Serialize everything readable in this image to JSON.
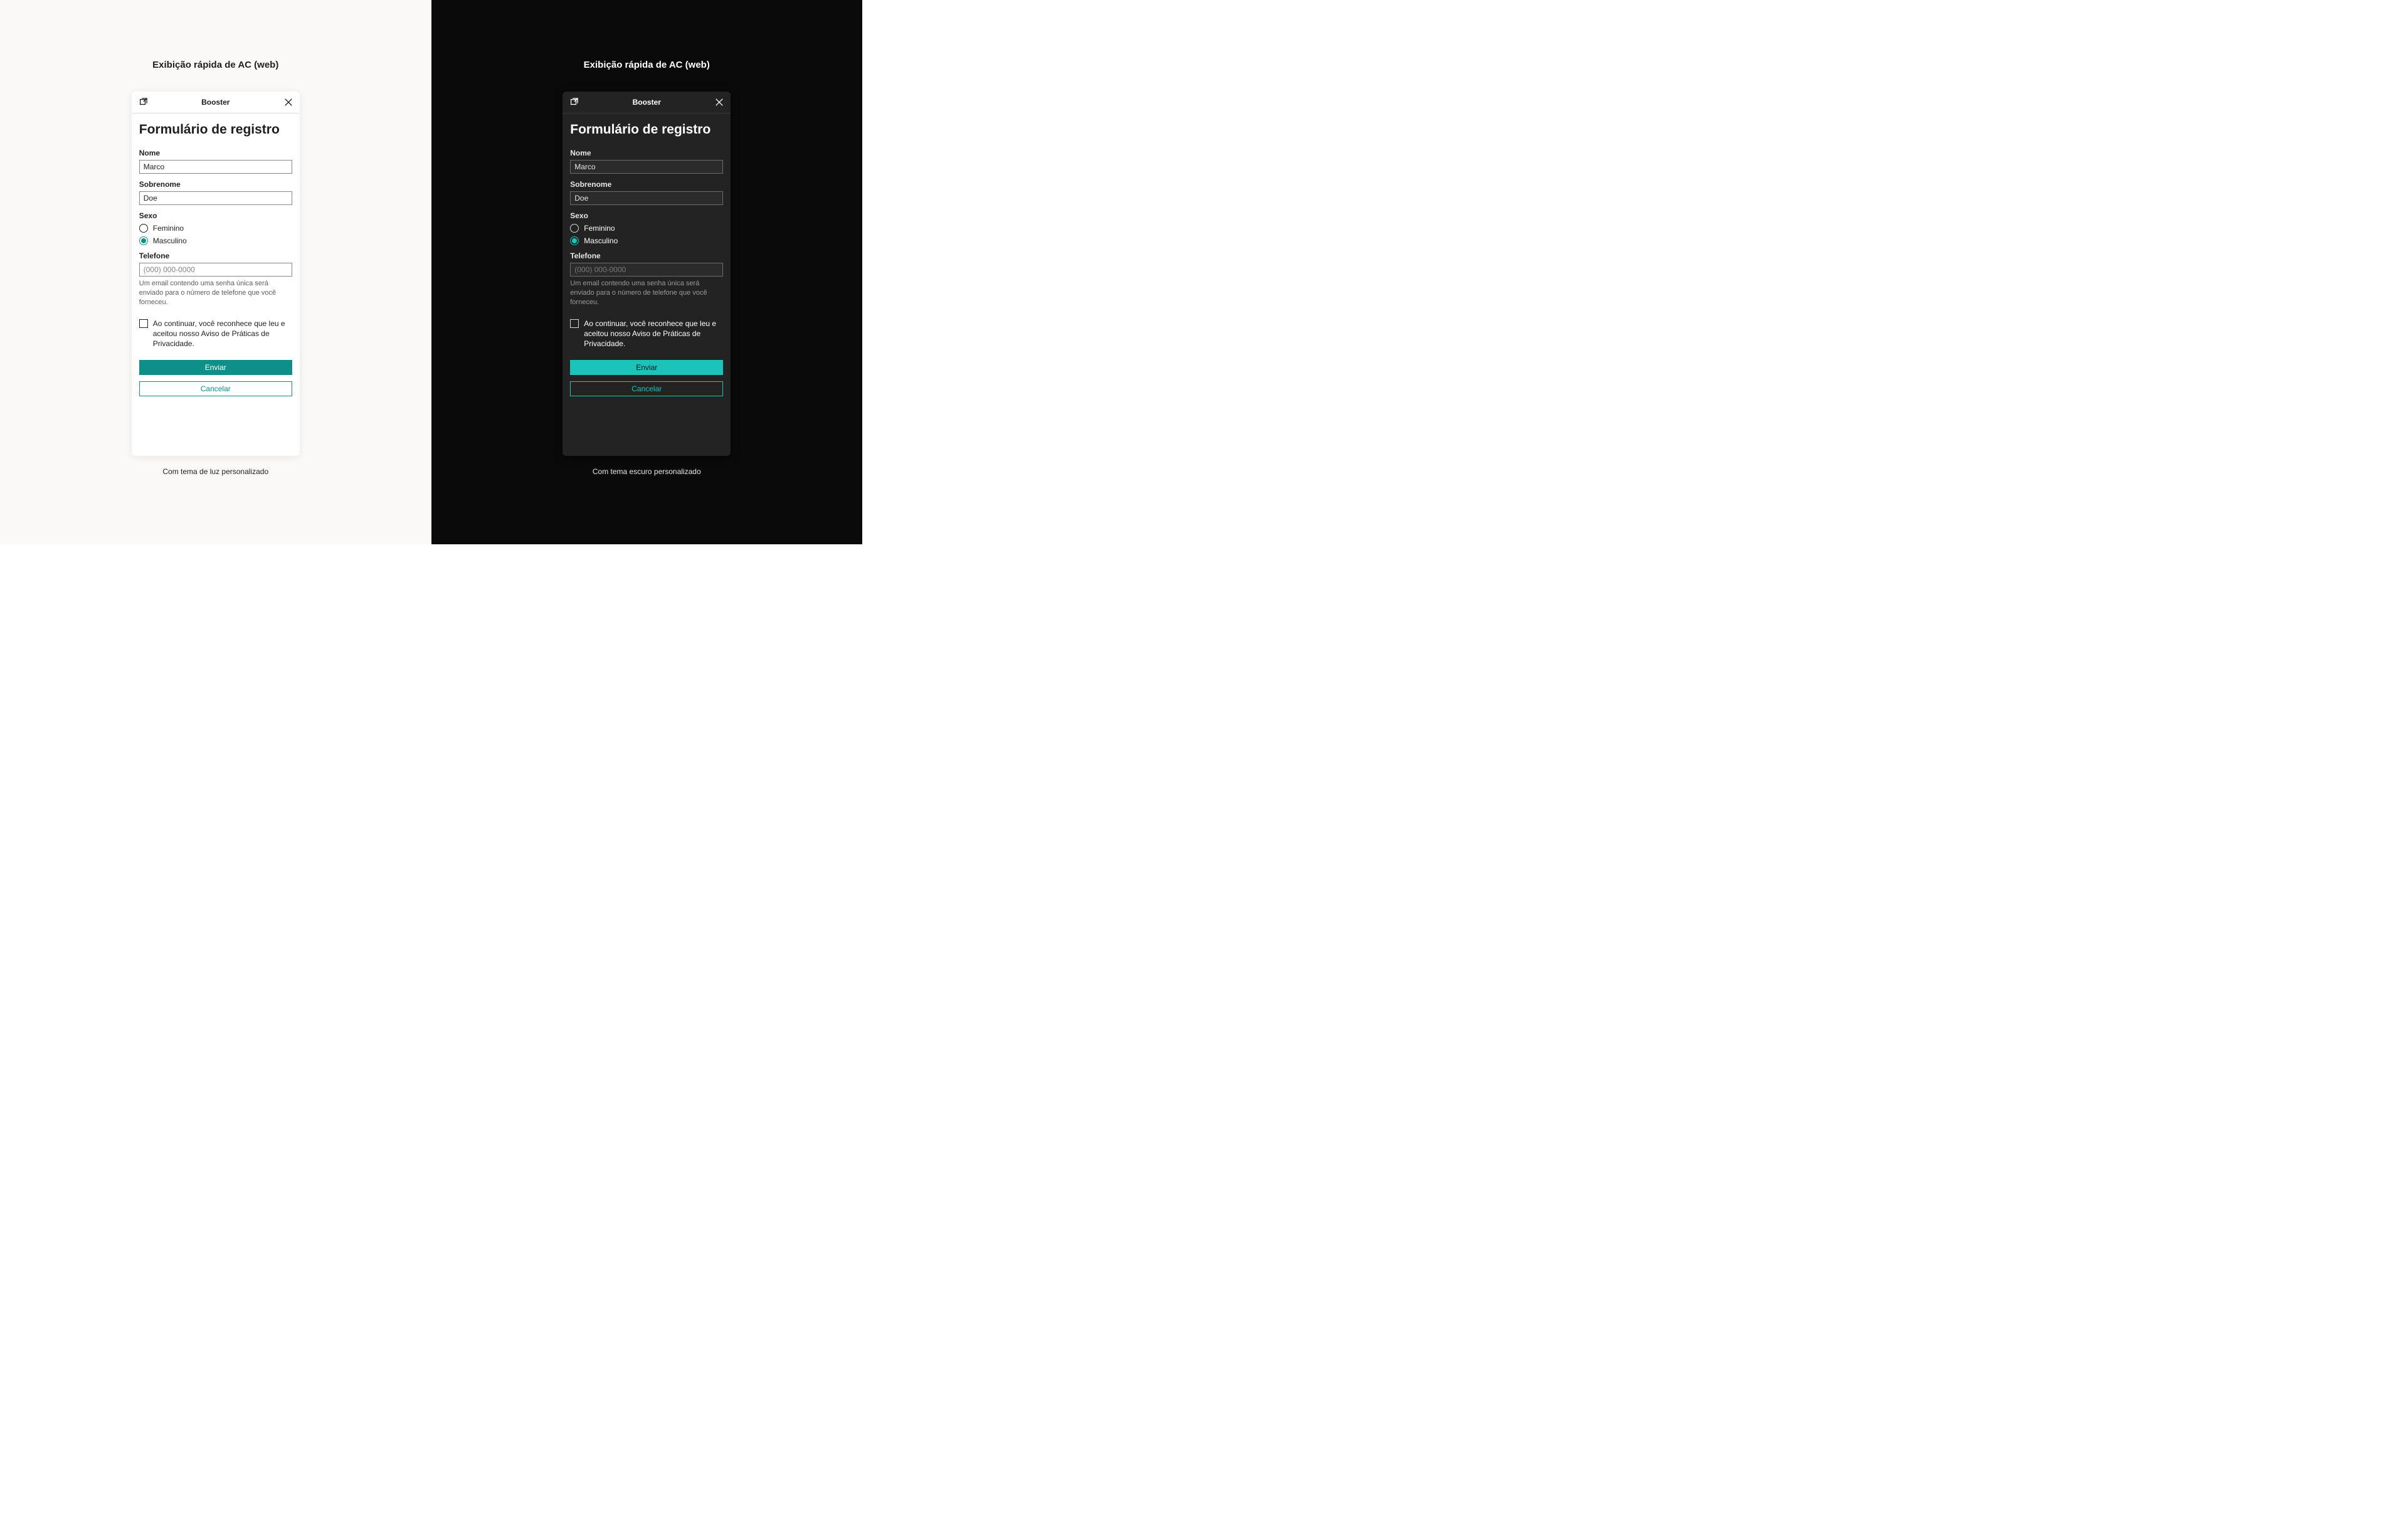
{
  "columns": [
    {
      "title": "Exibição rápida de AC (web)",
      "caption": "Com tema de luz personalizado"
    },
    {
      "title": "Exibição rápida de AC (web)",
      "caption": "Com tema escuro personalizado"
    }
  ],
  "card": {
    "header_title": "Booster",
    "form_title": "Formulário de registro",
    "fields": {
      "first_name": {
        "label": "Nome",
        "value": "Marco"
      },
      "last_name": {
        "label": "Sobrenome",
        "value": "Doe"
      },
      "sex": {
        "label": "Sexo",
        "options": [
          {
            "label": "Feminino",
            "checked": false
          },
          {
            "label": "Masculino",
            "checked": true
          }
        ]
      },
      "phone": {
        "label": "Telefone",
        "placeholder": "(000) 000-0000",
        "helper": "Um email contendo uma senha única será enviado para o número de telefone que você forneceu."
      },
      "consent": {
        "label": "Ao continuar, você reconhece que leu e aceitou nosso Aviso de Práticas de Privacidade."
      }
    },
    "buttons": {
      "submit": "Enviar",
      "cancel": "Cancelar"
    }
  }
}
